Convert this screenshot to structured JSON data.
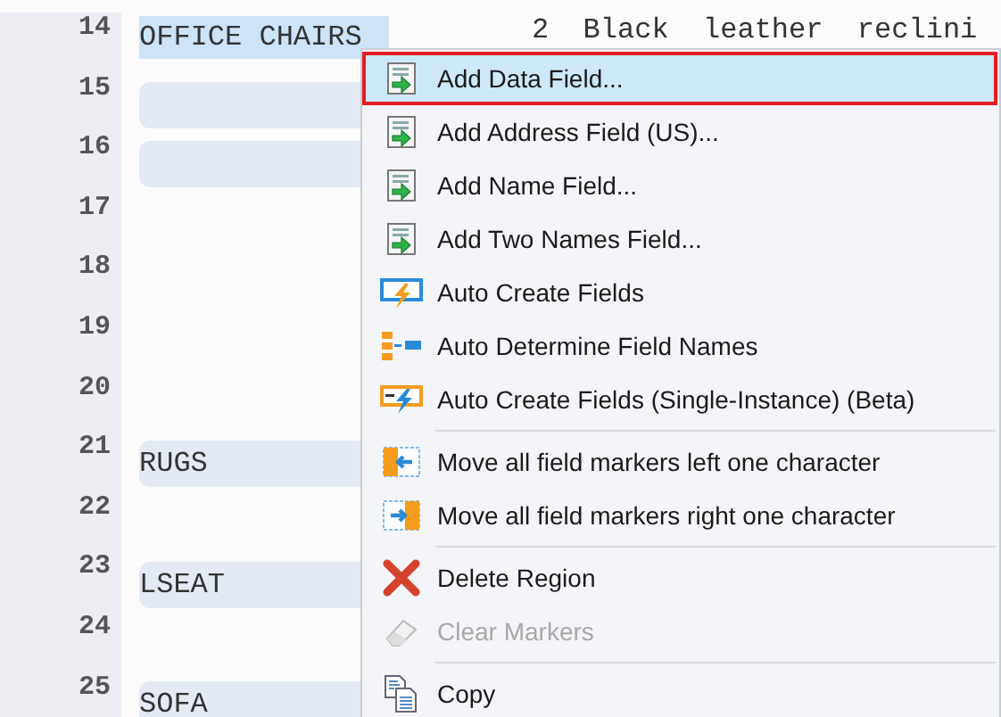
{
  "editor": {
    "lines": [
      {
        "number": "14",
        "text": "OFFICE CHAIRS",
        "text_2": "2  Black  leather  reclini",
        "selected": true,
        "band": false
      },
      {
        "number": "15",
        "selected": false,
        "band": true
      },
      {
        "number": "16",
        "selected": false,
        "band": true
      },
      {
        "number": "17",
        "selected": false,
        "band": false
      },
      {
        "number": "18",
        "selected": false,
        "band": false
      },
      {
        "number": "19",
        "selected": false,
        "band": false
      },
      {
        "number": "20",
        "selected": false,
        "band": false
      },
      {
        "number": "21",
        "text": "RUGS",
        "selected": false,
        "band": true
      },
      {
        "number": "22",
        "selected": false,
        "band": false
      },
      {
        "number": "23",
        "text": "LSEAT",
        "selected": false,
        "band": true
      },
      {
        "number": "24",
        "selected": false,
        "band": false
      },
      {
        "number": "25",
        "text": "SOFA",
        "selected": false,
        "band": true
      }
    ]
  },
  "context_menu": {
    "items": [
      {
        "kind": "item",
        "label": "Add Data Field...",
        "selected": true,
        "disabled": false
      },
      {
        "kind": "item",
        "label": "Add Address Field (US)...",
        "selected": false,
        "disabled": false
      },
      {
        "kind": "item",
        "label": "Add Name Field...",
        "selected": false,
        "disabled": false
      },
      {
        "kind": "item",
        "label": "Add Two Names Field...",
        "selected": false,
        "disabled": false
      },
      {
        "kind": "item",
        "label": "Auto Create Fields",
        "selected": false,
        "disabled": false
      },
      {
        "kind": "item",
        "label": "Auto Determine Field Names",
        "selected": false,
        "disabled": false
      },
      {
        "kind": "item",
        "label": "Auto Create Fields (Single-Instance) (Beta)",
        "selected": false,
        "disabled": false
      },
      {
        "kind": "separator"
      },
      {
        "kind": "item",
        "label": "Move all field markers left one character",
        "selected": false,
        "disabled": false
      },
      {
        "kind": "item",
        "label": "Move all field markers right one character",
        "selected": false,
        "disabled": false
      },
      {
        "kind": "separator"
      },
      {
        "kind": "item",
        "label": "Delete Region",
        "selected": false,
        "disabled": false
      },
      {
        "kind": "item",
        "label": "Clear Markers",
        "selected": false,
        "disabled": true
      },
      {
        "kind": "separator"
      },
      {
        "kind": "item",
        "label": "Copy",
        "selected": false,
        "disabled": false
      }
    ]
  }
}
